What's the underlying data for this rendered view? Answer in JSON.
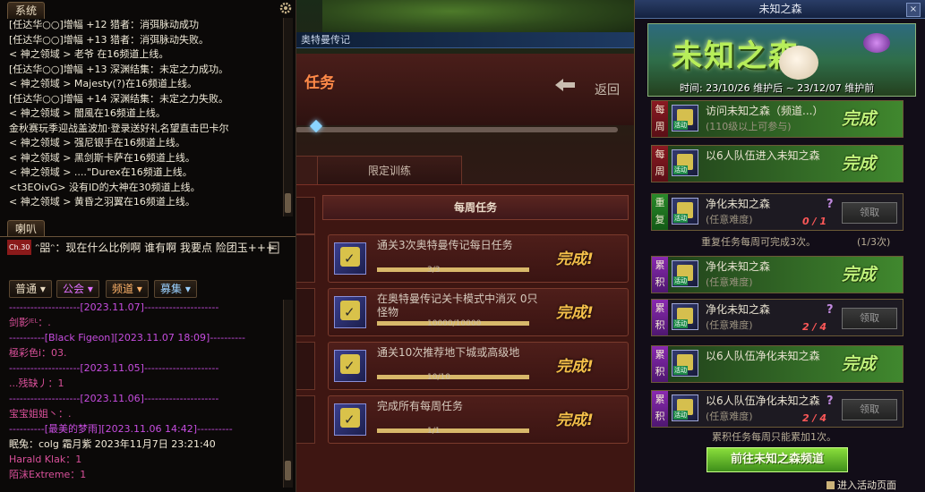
{
  "chat": {
    "system_tab": "系统",
    "system_lines": [
      "[任达华○○]增幅 +12 猎者：消弭脉动成功",
      "[任达华○○]增幅 +13 猎者：消弭脉动失败。",
      "<  神之领域  >  老爷  在16频道上线。",
      "[任达华○○]增幅 +13 深渊结集：未定之力成功。",
      "<  神之领域  > Majesty(?)在16频道上线。",
      "[任达华○○]增幅 +14 深渊结集：未定之力失败。",
      "<  神之领域  >    闇風在16频道上线。",
      "金秋赛玩季迎战盖波加·登录送好礼名望直击巴卡尔",
      "<  神之领域  > 强尼银手在16频道上线。",
      "<  神之领域  > 黑剑斯卡萨在16频道上线。",
      "<  神之领域  > ....\"Durex在16频道上线。",
      "<t3EOivG> 没有ID的大神在30频道上线。",
      "<  神之领域  > 黄昏之羽翼在16频道上线。"
    ],
    "horn_tab": "喇叭",
    "horn_channel": "Ch.30",
    "horn_message": "ᵔ㗊ᵔ：现在什么比例啊  谁有啊  我要点 险团玉+++",
    "dropdowns": [
      "普通",
      "公会",
      "频道",
      "募集"
    ],
    "lower_lines": [
      {
        "text": "--------------------[2023.11.07]---------------------",
        "style": "sep"
      },
      {
        "text": "剑影ᴶᴱᴸ：.",
        "style": "name"
      },
      {
        "text": "----------[Black Figeon][2023.11.07 18:09]----------",
        "style": "sep"
      },
      {
        "text": "極彩色i：03.",
        "style": "name"
      },
      {
        "text": "--------------------[2023.11.05]---------------------",
        "style": "sep"
      },
      {
        "text": "...残缺丿：1",
        "style": "name"
      },
      {
        "text": "--------------------[2023.11.06]---------------------",
        "style": "sep"
      },
      {
        "text": "宝宝姐姐丶：.",
        "style": "name"
      },
      {
        "text": "----------[最美的梦雨][2023.11.06 14:42]----------",
        "style": "sep"
      },
      {
        "text": "眠兔：colg    霜月紫    2023年11月7日 23:21:40",
        "style": "white"
      },
      {
        "text": "Harald Klak：1",
        "style": "name"
      },
      {
        "text": "陌沫Extreme：1",
        "style": "name"
      }
    ]
  },
  "mission": {
    "window_title": "奥特曼传记",
    "header": "任务",
    "back_label": "返回",
    "tab_limited": "限定训练",
    "weekly_header": "每周任务",
    "tasks": [
      {
        "text": "通关3次奥特曼传记每日任务",
        "progress": "3/3",
        "fraction": 1.0,
        "status": "完成!"
      },
      {
        "text": "在奥特曼传记关卡模式中消灭 0只怪物",
        "progress": "10000/10000",
        "fraction": 1.0,
        "status": "完成!"
      },
      {
        "text": "通关10次推荐地下城或高级地",
        "progress": "10/10",
        "fraction": 1.0,
        "status": "完成!"
      },
      {
        "text": "完成所有每周任务",
        "progress": "1/1",
        "fraction": 1.0,
        "status": "完成!"
      }
    ]
  },
  "event": {
    "title": "未知之森",
    "close": "×",
    "banner_title": "未知之森",
    "time": "时间: 23/10/26 维护后 ~ 23/12/07 维护前",
    "rows": [
      {
        "tag": "每周",
        "kind": "week",
        "title": "访问未知之森（频道...）",
        "sub": "(110级以上可参与)",
        "state": "done",
        "status": "完成"
      },
      {
        "tag": "每周",
        "kind": "week",
        "title": "以6人队伍进入未知之森",
        "sub": "",
        "state": "done",
        "status": "完成"
      },
      {
        "tag": "重复",
        "kind": "rep",
        "title": "净化未知之森",
        "sub": "(任意难度)",
        "state": "claim",
        "count": "0 / 1",
        "button": "领取"
      },
      {
        "tag": "累积",
        "kind": "acc",
        "title": "净化未知之森",
        "sub": "(任意难度)",
        "state": "done",
        "status": "完成"
      },
      {
        "tag": "累积",
        "kind": "acc",
        "title": "净化未知之森",
        "sub": "(任意难度)",
        "state": "claim",
        "count": "2 / 4",
        "button": "领取"
      },
      {
        "tag": "累积",
        "kind": "acc",
        "title": "以6人队伍净化未知之森",
        "sub": "",
        "state": "done",
        "status": "完成"
      },
      {
        "tag": "累积",
        "kind": "acc",
        "title": "以6人队伍净化未知之森",
        "sub": "(任意难度)",
        "state": "claim",
        "count": "2 / 4",
        "button": "领取"
      }
    ],
    "repeat_note": "重复任务每周可完成3次。",
    "repeat_count": "(1/3次)",
    "acc_note": "累积任务每周只能累加1次。",
    "goto_button": "前往未知之森频道",
    "enter_page": "进入活动页面"
  }
}
